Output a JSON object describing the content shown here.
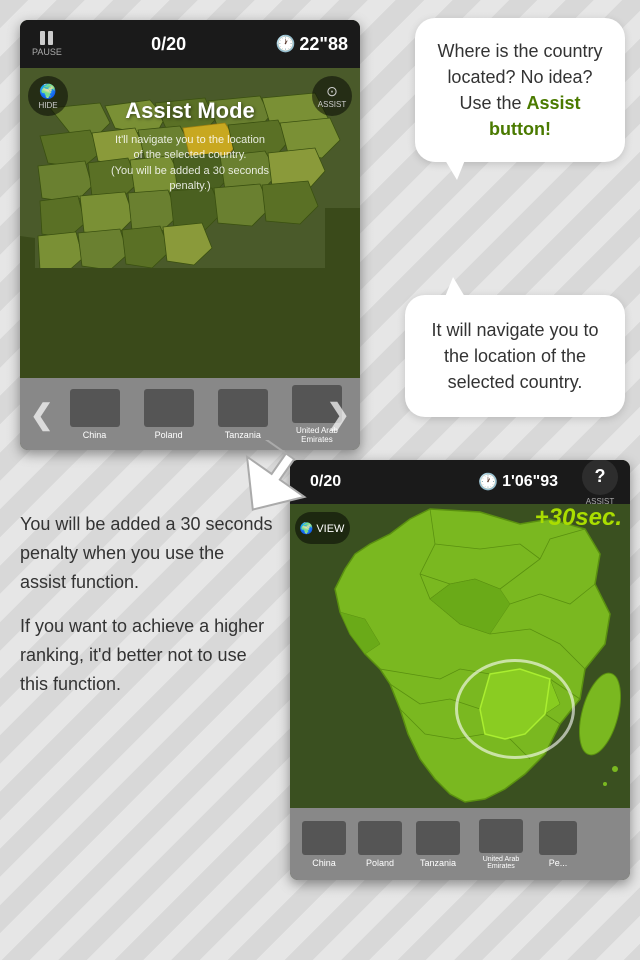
{
  "top_screenshot": {
    "score": "0/20",
    "timer": "22\"88",
    "pause_label": "PAUSE",
    "hide_label": "HIDE",
    "assist_label": "ASSIST",
    "assist_mode_title": "Assist Mode",
    "assist_subtext_line1": "It'll navigate you to the location",
    "assist_subtext_line2": "of the selected country.",
    "assist_subtext_line3": "(You will be added a 30 seconds penalty.)",
    "countries": [
      {
        "name": "China",
        "short": "China"
      },
      {
        "name": "Poland",
        "short": "Poland"
      },
      {
        "name": "Tanzania",
        "short": "Tanzania"
      },
      {
        "name": "United Arab Emirates",
        "short": "United Arab\nEmirates"
      }
    ]
  },
  "bubble1": {
    "line1": "Where is",
    "line2": "the country",
    "line3": "located? No idea?",
    "line4": "Use the",
    "bold": "Assist button!"
  },
  "bubble2": {
    "text": "It will navigate you to the location of the selected country."
  },
  "bottom_screenshot": {
    "score": "0/20",
    "timer": "1'06\"93",
    "penalty": "+30sec.",
    "view_label": "VIEW",
    "assist_label": "ASSIST",
    "countries": [
      {
        "name": "China",
        "short": "China"
      },
      {
        "name": "Poland",
        "short": "Poland"
      },
      {
        "name": "Tanzania",
        "short": "Tanzania"
      },
      {
        "name": "United Arab Emirates",
        "short": "United Arab\nEmirates"
      },
      {
        "name": "Peru",
        "short": "Pe..."
      }
    ]
  },
  "left_text": {
    "para1": "You will be added a 30 seconds penalty when you use the assist function.",
    "para2": " If you want to achieve a higher ranking, it'd better not to use this function."
  }
}
